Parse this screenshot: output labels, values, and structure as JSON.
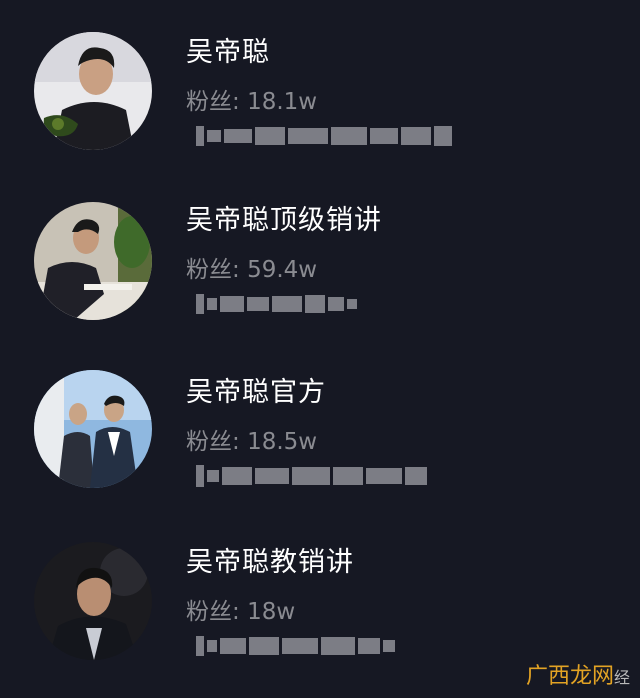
{
  "accounts": [
    {
      "name": "吴帝聪",
      "fans_label": "粉丝:",
      "fans": "18.1w"
    },
    {
      "name": "吴帝聪顶级销讲",
      "fans_label": "粉丝:",
      "fans": "59.4w"
    },
    {
      "name": "吴帝聪官方",
      "fans_label": "粉丝:",
      "fans": "18.5w"
    },
    {
      "name": "吴帝聪教销讲",
      "fans_label": "粉丝:",
      "fans": "18w"
    }
  ],
  "watermark": {
    "text": "广西龙网",
    "tail": "经"
  },
  "colors": {
    "background": "#161823",
    "name": "#ffffff",
    "fans": "#8a8b91"
  }
}
